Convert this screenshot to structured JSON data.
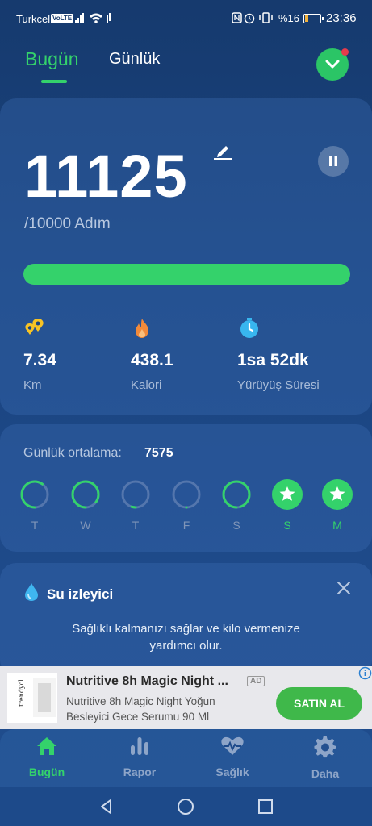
{
  "status_bar": {
    "carrier": "Turkcell",
    "volte": "VoLTE",
    "battery_pct": "%16",
    "time": "23:36"
  },
  "tabs": {
    "today": "Bugün",
    "daily": "Günlük"
  },
  "steps": {
    "count": "11125",
    "goal": "/10000 Adım",
    "progress": 1.0
  },
  "stats": [
    {
      "value": "7.34",
      "label": "Km",
      "icon": "location-pins-icon"
    },
    {
      "value": "438.1",
      "label": "Kalori",
      "icon": "flame-icon"
    },
    {
      "value": "1sa 52dk",
      "label": "Yürüyüş Süresi",
      "icon": "stopwatch-icon"
    }
  ],
  "weekly": {
    "avg_label": "Günlük ortalama:",
    "avg_value": "7575",
    "days": [
      {
        "label": "T",
        "progress": 0.6,
        "star": false,
        "active": false
      },
      {
        "label": "W",
        "progress": 0.85,
        "star": false,
        "active": false
      },
      {
        "label": "T",
        "progress": 0.05,
        "star": false,
        "active": false
      },
      {
        "label": "F",
        "progress": 0.0,
        "star": false,
        "active": false
      },
      {
        "label": "S",
        "progress": 0.95,
        "star": false,
        "active": false
      },
      {
        "label": "S",
        "progress": 1.0,
        "star": true,
        "active": true
      },
      {
        "label": "M",
        "progress": 1.0,
        "star": true,
        "active": true
      }
    ]
  },
  "water": {
    "title": "Su izleyici",
    "description": "Sağlıklı kalmanızı sağlar ve kilo vermenize yardımcı olur."
  },
  "ad": {
    "image_text": "trendyol",
    "title": "Nutritive 8h Magic Night ...",
    "badge": "AD",
    "description": "Nutritive 8h Magic Night Yoğun Besleyici Gece Serumu 90 Ml",
    "button": "SATIN AL"
  },
  "nav": [
    {
      "label": "Bugün",
      "icon": "home-icon",
      "active": true
    },
    {
      "label": "Rapor",
      "icon": "bar-chart-icon",
      "active": false
    },
    {
      "label": "Sağlık",
      "icon": "heart-pulse-icon",
      "active": false
    },
    {
      "label": "Daha",
      "icon": "gear-icon",
      "active": false
    }
  ],
  "colors": {
    "accent": "#34d26b",
    "background": "#1a4480"
  }
}
